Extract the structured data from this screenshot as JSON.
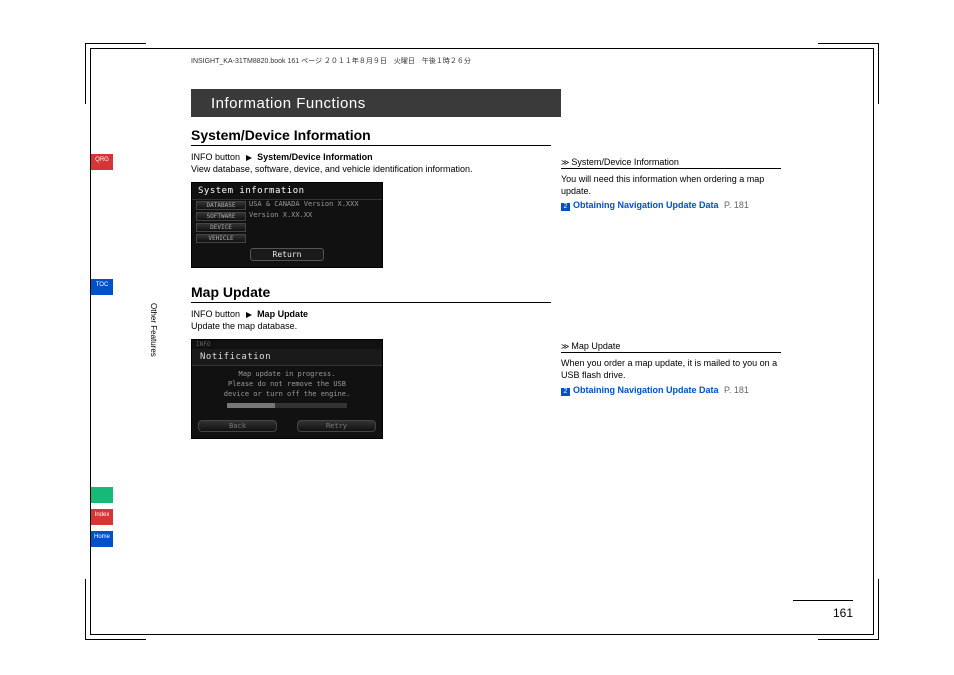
{
  "print_info": "INSIGHT_KA-31TM8820.book  161 ページ  ２０１１年８月９日　火曜日　午後１時２６分",
  "chapter_title": "Information Functions",
  "section1": {
    "heading": "System/Device Information",
    "path_prefix": "INFO button",
    "path_suffix": "System/Device Information",
    "description": "View database, software, device, and vehicle identification information.",
    "shot": {
      "title": "System information",
      "btn1": "DATABASE",
      "val1": "USA & CANADA  Version X.XXX",
      "btn2": "SOFTWARE",
      "val2": "Version X.XX.XX",
      "btn3": "DEVICE",
      "btn4": "VEHICLE",
      "return": "Return"
    }
  },
  "section2": {
    "heading": "Map Update",
    "path_prefix": "INFO button",
    "path_suffix": "Map Update",
    "description": "Update the map database.",
    "shot": {
      "tag": "INFO",
      "title": "Notification",
      "line1": "Map update in progress.",
      "line2": "Please do not remove the USB",
      "line3": "device or turn off the engine.",
      "btn_back": "Back",
      "btn_retry": "Retry"
    }
  },
  "side1": {
    "heading": "System/Device Information",
    "text": "You will need this information when ordering a map update.",
    "link": "Obtaining Navigation Update Data",
    "page": "P. 181"
  },
  "side2": {
    "heading": "Map Update",
    "text": "When you order a map update, it is mailed to you on a USB flash drive.",
    "link": "Obtaining Navigation Update Data",
    "page": "P. 181"
  },
  "nav": {
    "qrg": "QRG",
    "toc": "TOC",
    "voice": "",
    "index": "Index",
    "home": "Home",
    "vertical": "Other Features"
  },
  "page_number": "161"
}
